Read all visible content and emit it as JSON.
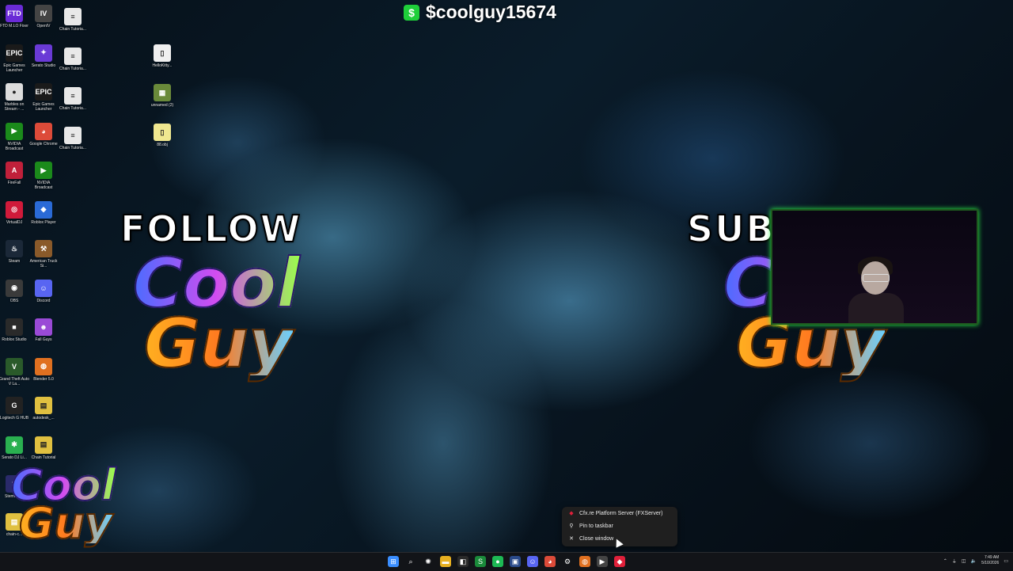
{
  "cashtag": {
    "icon": "$",
    "text": "$coolguy15674"
  },
  "overlay": {
    "left_title": "FOLLOW",
    "right_title": "SUBS",
    "logo_line1": "Cool",
    "logo_line2": "Guy",
    "logo_bang": "!"
  },
  "desktop": {
    "col1": [
      {
        "label": "FTD M.LO Fixer",
        "icon": "FTD",
        "color": "#6a2bd6"
      },
      {
        "label": "Epic Games Launcher",
        "icon": "EPIC",
        "color": "#1a1a1a"
      },
      {
        "label": "Marbles on Stream - ...",
        "icon": "●",
        "color": "#dddddd"
      },
      {
        "label": "NVIDIA Broadcast",
        "icon": "▶",
        "color": "#1b8a1b"
      },
      {
        "label": "FireFall",
        "icon": "A",
        "color": "#c0203a"
      },
      {
        "label": "VirtualDJ",
        "icon": "◎",
        "color": "#d01a3a"
      },
      {
        "label": "Steam",
        "icon": "♨",
        "color": "#1b2838"
      },
      {
        "label": "OBS",
        "icon": "◉",
        "color": "#3a3a3a"
      },
      {
        "label": "Roblox Studio",
        "icon": "■",
        "color": "#2a2a2a"
      },
      {
        "label": "Grand Theft Auto V La...",
        "icon": "V",
        "color": "#2a5a2a"
      },
      {
        "label": "Logitech G HUB",
        "icon": "G",
        "color": "#222222"
      },
      {
        "label": "Serato DJ Li...",
        "icon": "✱",
        "color": "#2ab050"
      }
    ],
    "col2": [
      {
        "label": "OpenIV",
        "icon": "IV",
        "color": "#444444"
      },
      {
        "label": "Serato Studio",
        "icon": "✦",
        "color": "#6a3ad6"
      },
      {
        "label": "Epic Games Launcher",
        "icon": "EPIC",
        "color": "#1a1a1a"
      },
      {
        "label": "Google Chrome",
        "icon": "◕",
        "color": "#dd4b39"
      },
      {
        "label": "NVIDIA Broadcast",
        "icon": "▶",
        "color": "#1b8a1b"
      },
      {
        "label": "Roblox Player",
        "icon": "◆",
        "color": "#2a6ad6"
      },
      {
        "label": "American Truck Si...",
        "icon": "⚒",
        "color": "#8a5a2a"
      },
      {
        "label": "Discord",
        "icon": "☺",
        "color": "#5865f2"
      },
      {
        "label": "Fall Guys",
        "icon": "☻",
        "color": "#9a4ad6"
      },
      {
        "label": "Blender 5.0",
        "icon": "◍",
        "color": "#e07020"
      },
      {
        "label": "autodesk_...",
        "icon": "▤",
        "color": "#e0c040"
      },
      {
        "label": "Chain Tutorial",
        "icon": "▤",
        "color": "#e0c040"
      }
    ],
    "col3": [
      {
        "label": "Chain Tutoria...",
        "icon": "≡",
        "color": "#e8e8e8"
      },
      {
        "label": "Chain Tutoria...",
        "icon": "≡",
        "color": "#e8e8e8"
      },
      {
        "label": "Chain Tutoria...",
        "icon": "≡",
        "color": "#e8e8e8"
      },
      {
        "label": "Chain Tutoria...",
        "icon": "≡",
        "color": "#e8e8e8"
      }
    ],
    "col4": [
      {
        "label": "HelloKitty...",
        "icon": "▯",
        "color": "#f0f0f0"
      },
      {
        "label": "unnamed (2)",
        "icon": "▦",
        "color": "#6a8a3a"
      },
      {
        "label": "88.obj",
        "icon": "▯",
        "color": "#f0e890"
      }
    ],
    "col1_extra": [
      {
        "label": "Stemm SE",
        "icon": "S",
        "color": "#2a2a6a"
      },
      {
        "label": "chain-c...",
        "icon": "▤",
        "color": "#e0c040"
      }
    ]
  },
  "context_menu": {
    "items": [
      {
        "label": "Cfx.re Platform Server (FXServer)",
        "icon": "cfx-icon",
        "glyph": "◆"
      },
      {
        "label": "Pin to taskbar",
        "icon": "pin-icon",
        "glyph": "⚲"
      },
      {
        "label": "Close window",
        "icon": "close-icon",
        "glyph": "✕"
      }
    ]
  },
  "taskbar": {
    "apps": [
      {
        "name": "start-icon",
        "glyph": "⊞",
        "color": "#3a8eff"
      },
      {
        "name": "search-icon",
        "glyph": "⌕",
        "color": "#121418"
      },
      {
        "name": "widgets-icon",
        "glyph": "✺",
        "color": "#121418"
      },
      {
        "name": "file-explorer-icon",
        "glyph": "▬",
        "color": "#e8b020"
      },
      {
        "name": "store-icon",
        "glyph": "◧",
        "color": "#2a2a2a"
      },
      {
        "name": "spreadsheet-icon",
        "glyph": "S",
        "color": "#1a8a3a"
      },
      {
        "name": "spotify-icon",
        "glyph": "●",
        "color": "#1db954"
      },
      {
        "name": "app-icon",
        "glyph": "▣",
        "color": "#2a4a8a"
      },
      {
        "name": "discord-icon",
        "glyph": "☺",
        "color": "#5865f2"
      },
      {
        "name": "chrome-icon",
        "glyph": "◕",
        "color": "#dd4b39"
      },
      {
        "name": "gear-icon",
        "glyph": "⚙",
        "color": "#121418"
      },
      {
        "name": "blender-icon",
        "glyph": "◍",
        "color": "#e07020"
      },
      {
        "name": "media-icon",
        "glyph": "▶",
        "color": "#444444"
      },
      {
        "name": "cfx-icon",
        "glyph": "◆",
        "color": "#e0203a"
      }
    ],
    "clock_time": "7:49 AM",
    "clock_date": "5/10/2026"
  }
}
